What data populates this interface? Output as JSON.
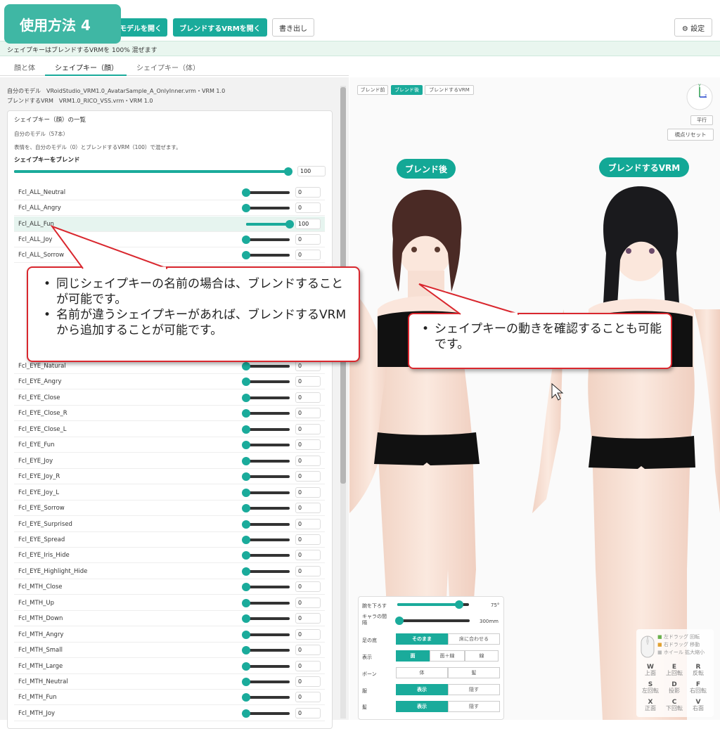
{
  "badge": "使用方法 4",
  "toolbar": {
    "open_model": "モデルを開く",
    "open_blend": "ブレンドするVRMを開く",
    "export": "書き出し",
    "settings": "⚙ 設定"
  },
  "status": "シェイプキーはブレンドするVRMを 100% 混ぜます",
  "tabs": [
    "顔と体",
    "シェイプキー（顔）",
    "シェイプキー（体）"
  ],
  "info": {
    "own_model": "自分のモデル　VRoidStudio_VRM1.0_AvatarSample_A_OnlyInner.vrm・VRM 1.0",
    "blend_vrm": "ブレンドするVRM　VRM1.0_RICO_VSS.vrm・VRM 1.0"
  },
  "card": {
    "title": "シェイプキー（顔）の一覧",
    "count": "自分のモデル（57本）",
    "desc": "表情を、自分のモデル（0）とブレンドするVRM（100）で混ぜます。",
    "blend_label": "シェイプキーをブレンド",
    "blend_value": 100
  },
  "shapekeys": [
    {
      "name": "Fcl_ALL_Neutral",
      "value": 0
    },
    {
      "name": "Fcl_ALL_Angry",
      "value": 0
    },
    {
      "name": "Fcl_ALL_Fun",
      "value": 100
    },
    {
      "name": "Fcl_ALL_Joy",
      "value": 0
    },
    {
      "name": "Fcl_ALL_Sorrow",
      "value": 0
    },
    {
      "name": "Fcl_EYE_Natural",
      "value": 0
    },
    {
      "name": "Fcl_EYE_Angry",
      "value": 0
    },
    {
      "name": "Fcl_EYE_Close",
      "value": 0
    },
    {
      "name": "Fcl_EYE_Close_R",
      "value": 0
    },
    {
      "name": "Fcl_EYE_Close_L",
      "value": 0
    },
    {
      "name": "Fcl_EYE_Fun",
      "value": 0
    },
    {
      "name": "Fcl_EYE_Joy",
      "value": 0
    },
    {
      "name": "Fcl_EYE_Joy_R",
      "value": 0
    },
    {
      "name": "Fcl_EYE_Joy_L",
      "value": 0
    },
    {
      "name": "Fcl_EYE_Sorrow",
      "value": 0
    },
    {
      "name": "Fcl_EYE_Surprised",
      "value": 0
    },
    {
      "name": "Fcl_EYE_Spread",
      "value": 0
    },
    {
      "name": "Fcl_EYE_Iris_Hide",
      "value": 0
    },
    {
      "name": "Fcl_EYE_Highlight_Hide",
      "value": 0
    },
    {
      "name": "Fcl_MTH_Close",
      "value": 0
    },
    {
      "name": "Fcl_MTH_Up",
      "value": 0
    },
    {
      "name": "Fcl_MTH_Down",
      "value": 0
    },
    {
      "name": "Fcl_MTH_Angry",
      "value": 0
    },
    {
      "name": "Fcl_MTH_Small",
      "value": 0
    },
    {
      "name": "Fcl_MTH_Large",
      "value": 0
    },
    {
      "name": "Fcl_MTH_Neutral",
      "value": 0
    },
    {
      "name": "Fcl_MTH_Fun",
      "value": 0
    },
    {
      "name": "Fcl_MTH_Joy",
      "value": 0
    }
  ],
  "viewport": {
    "view_buttons": [
      "ブレンド前",
      "ブレンド後",
      "ブレンドするVRM"
    ],
    "active_view": 1,
    "parallel": "平行",
    "reset_view": "視点リセット",
    "label_after": "ブレンド後",
    "label_blend": "ブレンドするVRM",
    "axis_labels": {
      "z": "z",
      "y": "Y"
    }
  },
  "callouts": {
    "left": [
      "同じシェイプキーの名前の場合は、ブレンドすることが可能です。",
      "名前が違うシェイプキーがあれば、ブレンドするVRMから追加することが可能です。"
    ],
    "right": [
      "シェイプキーの動きを確認することも可能です。"
    ]
  },
  "controls": {
    "arm_label": "腕を下ろす",
    "arm_value": "75°",
    "arm_fraction": 0.86,
    "spacing_label": "キャラの間隔",
    "spacing_value": "300mm",
    "spacing_fraction": 0.0,
    "feet_label": "足の底",
    "feet_options": [
      "そのまま",
      "床に合わせる"
    ],
    "feet_active": 0,
    "display_label": "表示",
    "display_options": [
      "面",
      "面＋線",
      "線"
    ],
    "display_active": 0,
    "bone_label": "ボーン",
    "bone_options": [
      "体",
      "髪"
    ],
    "bone_active": -1,
    "cloth_label": "服",
    "cloth_options": [
      "表示",
      "隠す"
    ],
    "cloth_active": 0,
    "hair_label": "髪",
    "hair_options": [
      "表示",
      "隠す"
    ],
    "hair_active": 0
  },
  "mouse_help": [
    "左ドラッグ 回転",
    "右ドラッグ 移動",
    "ホイール 拡大縮小"
  ],
  "keys": [
    {
      "k": "W",
      "t": "上面"
    },
    {
      "k": "E",
      "t": "上回転"
    },
    {
      "k": "R",
      "t": "反転"
    },
    {
      "k": "S",
      "t": "左回転"
    },
    {
      "k": "D",
      "t": "投影"
    },
    {
      "k": "F",
      "t": "右回転"
    },
    {
      "k": "X",
      "t": "正面"
    },
    {
      "k": "C",
      "t": "下回転"
    },
    {
      "k": "V",
      "t": "右面"
    }
  ]
}
